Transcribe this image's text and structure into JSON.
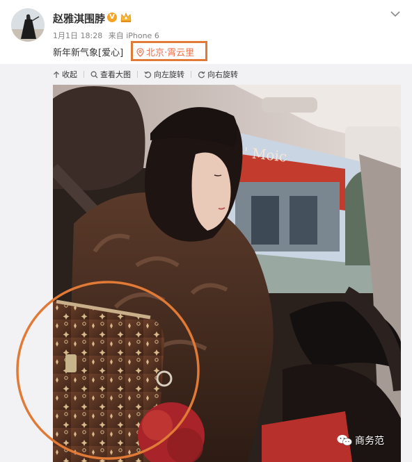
{
  "post": {
    "username": "赵雅淇围脖",
    "verified_mark": "V",
    "timestamp": "1月1日 18:28",
    "source": "来自 iPhone 6",
    "text": "新年新气象[爱心]",
    "location": "北京·霄云里"
  },
  "toolbar": {
    "collapse_label": "收起",
    "view_large_label": "查看大图",
    "rotate_left_label": "向左旋转",
    "rotate_right_label": "向右旋转"
  },
  "photo": {
    "storefront_sign": "e' Moic",
    "watermark": "商务范"
  },
  "colors": {
    "location_link": "#eb7350",
    "annotation_orange": "#e07a36",
    "verified_badge": "#f7a326",
    "background_gray": "#f2f2f5"
  },
  "icons": {
    "verified": "verified-v-icon",
    "vip": "vip-crown-icon",
    "location": "location-pin-icon",
    "collapse": "arrow-up-icon",
    "view_large": "magnifier-icon",
    "rotate_left": "rotate-left-icon",
    "rotate_right": "rotate-right-icon",
    "chevron": "chevron-down-icon",
    "watermark": "wechat-icon"
  }
}
